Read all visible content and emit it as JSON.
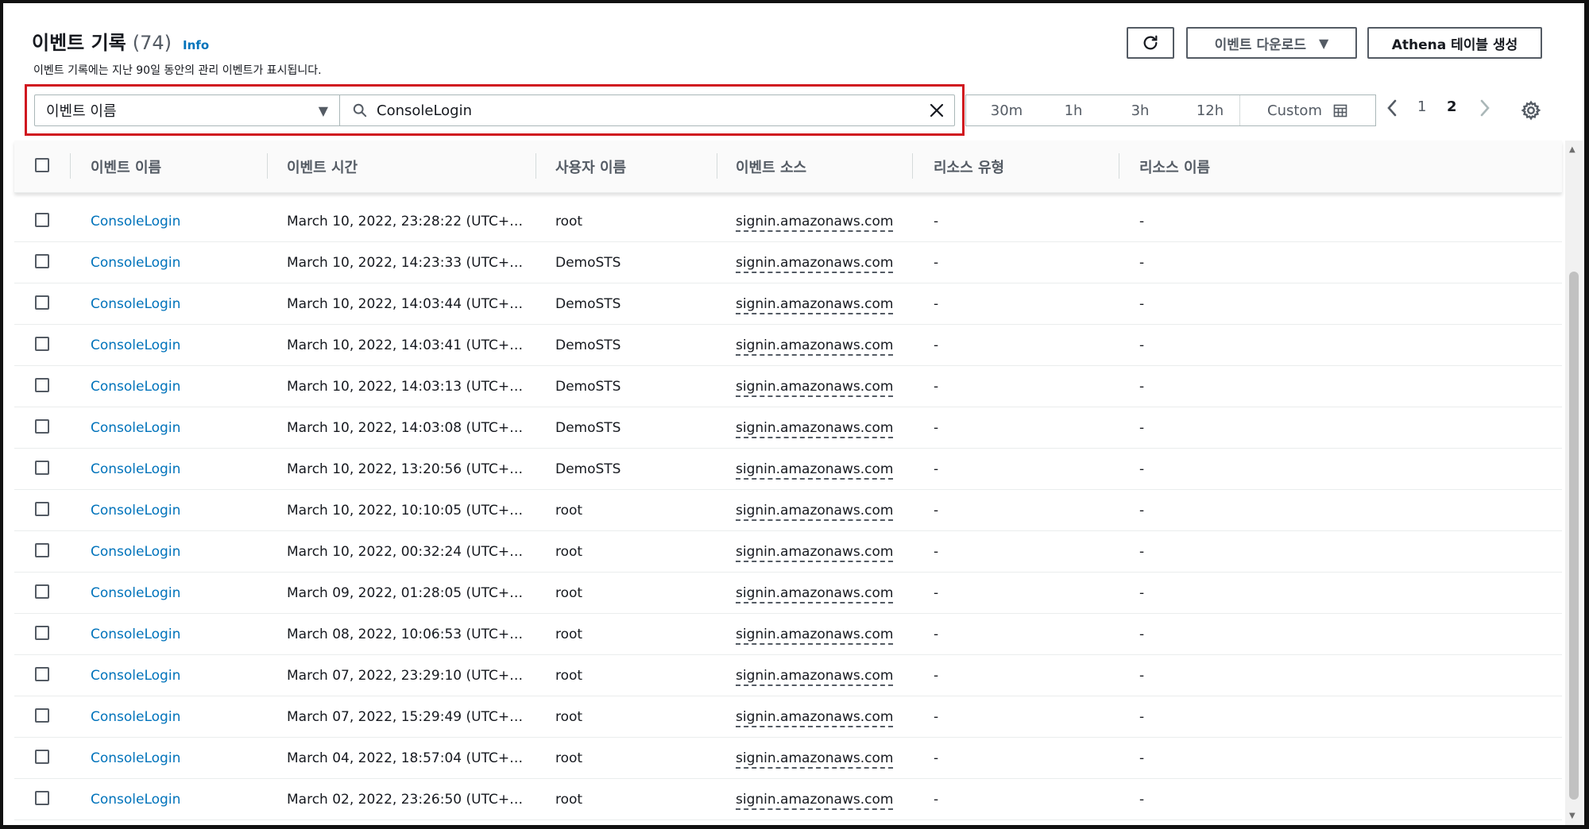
{
  "header": {
    "title": "이벤트 기록",
    "count": "(74)",
    "info_label": "Info",
    "subtitle": "이벤트 기록에는 지난 90일 동안의 관리 이벤트가 표시됩니다.",
    "download_label": "이벤트 다운로드",
    "athena_label": "Athena 테이블 생성"
  },
  "filter": {
    "attribute": "이벤트 이름",
    "search_value": "ConsoleLogin",
    "time_ranges": [
      "30m",
      "1h",
      "3h",
      "12h"
    ],
    "custom_label": "Custom"
  },
  "pagination": {
    "pages": [
      "1",
      "2"
    ],
    "current": "2"
  },
  "table": {
    "columns": [
      "이벤트 이름",
      "이벤트 시간",
      "사용자 이름",
      "이벤트 소스",
      "리소스 유형",
      "리소스 이름"
    ],
    "rows": [
      {
        "name": "ConsoleLogin",
        "time": "March 10, 2022, 23:28:22 (UTC+…",
        "user": "root",
        "source": "signin.amazonaws.com",
        "rtype": "-",
        "rname": "-"
      },
      {
        "name": "ConsoleLogin",
        "time": "March 10, 2022, 14:23:33 (UTC+…",
        "user": "DemoSTS",
        "source": "signin.amazonaws.com",
        "rtype": "-",
        "rname": "-"
      },
      {
        "name": "ConsoleLogin",
        "time": "March 10, 2022, 14:03:44 (UTC+…",
        "user": "DemoSTS",
        "source": "signin.amazonaws.com",
        "rtype": "-",
        "rname": "-"
      },
      {
        "name": "ConsoleLogin",
        "time": "March 10, 2022, 14:03:41 (UTC+…",
        "user": "DemoSTS",
        "source": "signin.amazonaws.com",
        "rtype": "-",
        "rname": "-"
      },
      {
        "name": "ConsoleLogin",
        "time": "March 10, 2022, 14:03:13 (UTC+…",
        "user": "DemoSTS",
        "source": "signin.amazonaws.com",
        "rtype": "-",
        "rname": "-"
      },
      {
        "name": "ConsoleLogin",
        "time": "March 10, 2022, 14:03:08 (UTC+…",
        "user": "DemoSTS",
        "source": "signin.amazonaws.com",
        "rtype": "-",
        "rname": "-"
      },
      {
        "name": "ConsoleLogin",
        "time": "March 10, 2022, 13:20:56 (UTC+…",
        "user": "DemoSTS",
        "source": "signin.amazonaws.com",
        "rtype": "-",
        "rname": "-"
      },
      {
        "name": "ConsoleLogin",
        "time": "March 10, 2022, 10:10:05 (UTC+…",
        "user": "root",
        "source": "signin.amazonaws.com",
        "rtype": "-",
        "rname": "-"
      },
      {
        "name": "ConsoleLogin",
        "time": "March 10, 2022, 00:32:24 (UTC+…",
        "user": "root",
        "source": "signin.amazonaws.com",
        "rtype": "-",
        "rname": "-"
      },
      {
        "name": "ConsoleLogin",
        "time": "March 09, 2022, 01:28:05 (UTC+…",
        "user": "root",
        "source": "signin.amazonaws.com",
        "rtype": "-",
        "rname": "-"
      },
      {
        "name": "ConsoleLogin",
        "time": "March 08, 2022, 10:06:53 (UTC+…",
        "user": "root",
        "source": "signin.amazonaws.com",
        "rtype": "-",
        "rname": "-"
      },
      {
        "name": "ConsoleLogin",
        "time": "March 07, 2022, 23:29:10 (UTC+…",
        "user": "root",
        "source": "signin.amazonaws.com",
        "rtype": "-",
        "rname": "-"
      },
      {
        "name": "ConsoleLogin",
        "time": "March 07, 2022, 15:29:49 (UTC+…",
        "user": "root",
        "source": "signin.amazonaws.com",
        "rtype": "-",
        "rname": "-"
      },
      {
        "name": "ConsoleLogin",
        "time": "March 04, 2022, 18:57:04 (UTC+…",
        "user": "root",
        "source": "signin.amazonaws.com",
        "rtype": "-",
        "rname": "-"
      },
      {
        "name": "ConsoleLogin",
        "time": "March 02, 2022, 23:26:50 (UTC+…",
        "user": "root",
        "source": "signin.amazonaws.com",
        "rtype": "-",
        "rname": "-"
      }
    ]
  },
  "icons": {
    "refresh": "refresh-icon",
    "download_caret": "caret-down-icon",
    "search": "search-icon",
    "clear": "close-icon",
    "calendar": "calendar-icon",
    "settings": "gear-icon"
  },
  "colors": {
    "link": "#0073bb",
    "highlight": "#d0161f",
    "text": "#16191f",
    "muted": "#545b64"
  }
}
